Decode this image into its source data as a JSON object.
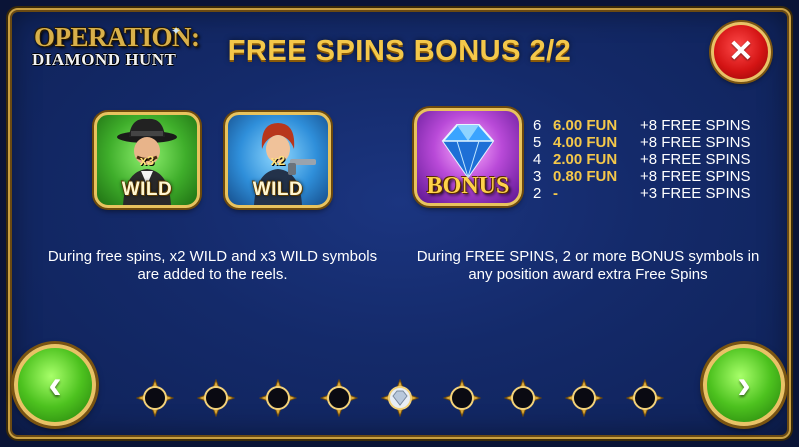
{
  "logo": {
    "line1": "OPERATION:",
    "line2": "DIAMOND HUNT"
  },
  "title": "FREE SPINS BONUS 2/2",
  "close_button": {
    "label": "✕",
    "icon": "close-icon"
  },
  "wild_symbols": [
    {
      "multiplier": "x3",
      "label": "WILD",
      "color": "#3fae2b"
    },
    {
      "multiplier": "x2",
      "label": "WILD",
      "color": "#2f8fda"
    }
  ],
  "bonus_symbol": {
    "label": "BONUS",
    "icon": "diamond-icon"
  },
  "paytable": [
    {
      "count": "6",
      "fun": "6.00 FUN",
      "spins": "+8 FREE SPINS"
    },
    {
      "count": "5",
      "fun": "4.00 FUN",
      "spins": "+8 FREE SPINS"
    },
    {
      "count": "4",
      "fun": "2.00 FUN",
      "spins": "+8 FREE SPINS"
    },
    {
      "count": "3",
      "fun": "0.80 FUN",
      "spins": "+8 FREE SPINS"
    },
    {
      "count": "2",
      "fun": "-",
      "spins": "+3 FREE SPINS"
    }
  ],
  "descriptions": {
    "left": "During free spins, x2 WILD and x3 WILD symbols are added to the reels.",
    "right": "During FREE SPINS, 2 or more BONUS symbols in any position award extra Free Spins"
  },
  "navigation": {
    "prev_label": "‹",
    "next_label": "›",
    "page_count": 9,
    "active_page": 5
  },
  "colors": {
    "background": "#142a6a",
    "accent_gold": "#f4c84a",
    "close_red": "#d41414",
    "nav_green": "#4dc21f"
  }
}
